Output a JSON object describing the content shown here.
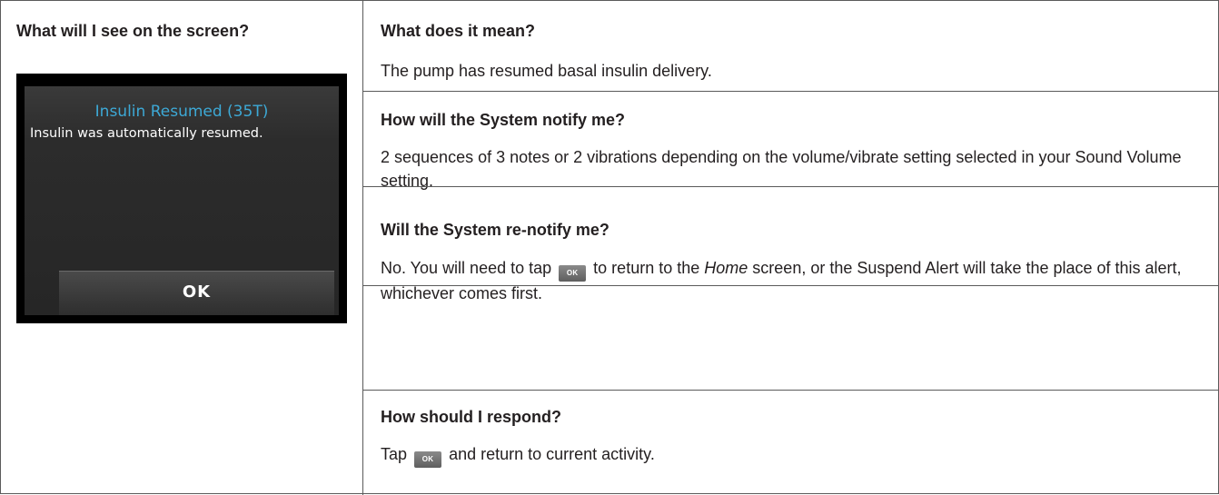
{
  "left": {
    "heading": "What will I see on the screen?",
    "screen": {
      "title": "Insulin Resumed (35T)",
      "message": "Insulin was automatically resumed.",
      "ok_button": "OK"
    }
  },
  "right": {
    "meaning": {
      "heading": "What does it mean?",
      "text": "The pump has resumed basal insulin delivery."
    },
    "notify": {
      "heading": "How will the System notify me?",
      "text": "2 sequences of 3 notes or 2 vibrations depending on the volume/vibrate setting selected in your Sound Volume setting."
    },
    "renotify": {
      "heading": "Will the System re-notify me?",
      "text_before": "No. You will need to tap",
      "ok_chip": "OK",
      "text_mid": "to return to the",
      "home": "Home",
      "text_after": "screen, or the Suspend Alert will take the place of this alert, whichever comes first."
    },
    "respond": {
      "heading": "How should I respond?",
      "text_before": "Tap",
      "ok_chip": "OK",
      "text_after": "and return to current activity."
    }
  }
}
